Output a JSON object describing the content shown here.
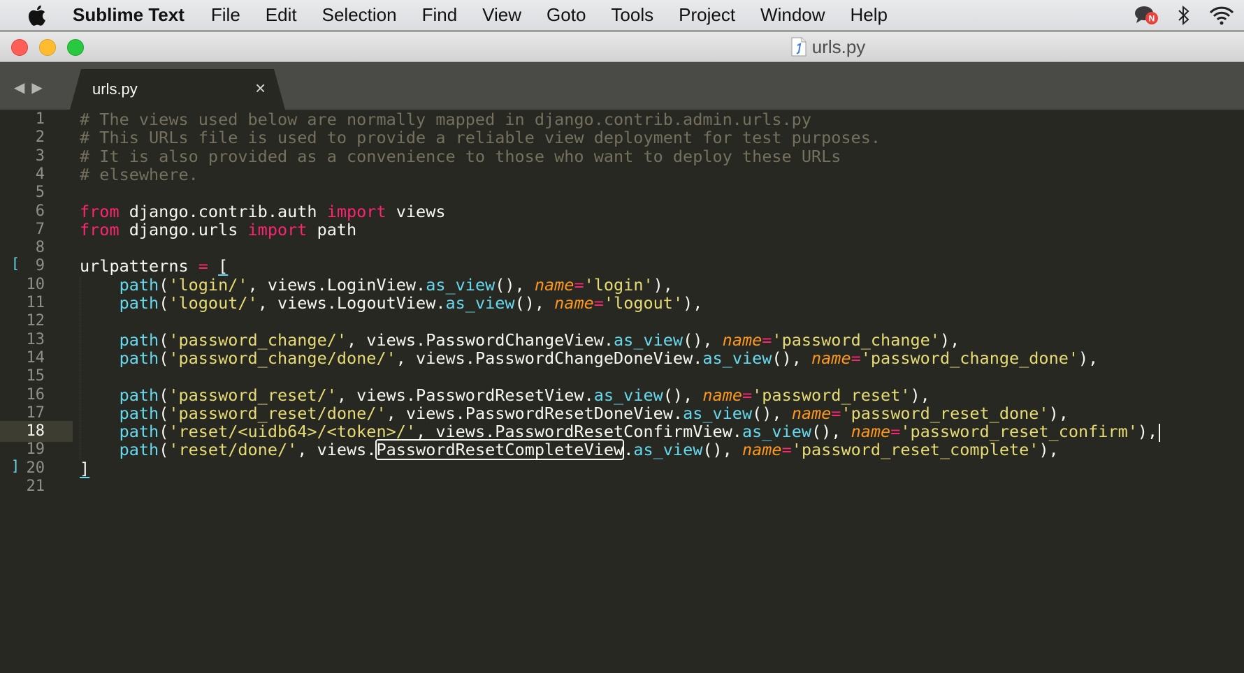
{
  "menubar": {
    "app_name": "Sublime Text",
    "items": [
      "File",
      "Edit",
      "Selection",
      "Find",
      "View",
      "Goto",
      "Tools",
      "Project",
      "Window",
      "Help"
    ],
    "status_icons": [
      "chat-notification-icon",
      "bluetooth-icon",
      "wifi-icon"
    ],
    "notification_badge": "N"
  },
  "window": {
    "title": "urls.py"
  },
  "tabs": [
    {
      "label": "urls.py",
      "active": true
    }
  ],
  "editor": {
    "active_line": 18,
    "line_numbers": [
      "1",
      "2",
      "3",
      "4",
      "5",
      "6",
      "7",
      "8",
      "9",
      "10",
      "11",
      "12",
      "13",
      "14",
      "15",
      "16",
      "17",
      "18",
      "19",
      "20",
      "21"
    ],
    "lines": [
      [
        {
          "t": "cm",
          "v": "# The views used below are normally mapped in django.contrib.admin.urls.py"
        }
      ],
      [
        {
          "t": "cm",
          "v": "# This URLs file is used to provide a reliable view deployment for test purposes."
        }
      ],
      [
        {
          "t": "cm",
          "v": "# It is also provided as a convenience to those who want to deploy these URLs"
        }
      ],
      [
        {
          "t": "cm",
          "v": "# elsewhere."
        }
      ],
      [],
      [
        {
          "t": "kw",
          "v": "from"
        },
        {
          "t": "",
          "v": " django.contrib.auth "
        },
        {
          "t": "kw",
          "v": "import"
        },
        {
          "t": "",
          "v": " views"
        }
      ],
      [
        {
          "t": "kw",
          "v": "from"
        },
        {
          "t": "",
          "v": " django.urls "
        },
        {
          "t": "kw",
          "v": "import"
        },
        {
          "t": "",
          "v": " path"
        }
      ],
      [],
      [
        {
          "t": "",
          "v": "urlpatterns "
        },
        {
          "t": "op",
          "v": "="
        },
        {
          "t": "",
          "v": " "
        },
        {
          "t": "bracket",
          "v": "["
        }
      ],
      [
        {
          "t": "",
          "v": "    "
        },
        {
          "t": "fn",
          "v": "path"
        },
        {
          "t": "",
          "v": "("
        },
        {
          "t": "st",
          "v": "'login/'"
        },
        {
          "t": "",
          "v": ", views.LoginView."
        },
        {
          "t": "fn",
          "v": "as_view"
        },
        {
          "t": "",
          "v": "(), "
        },
        {
          "t": "pa",
          "v": "name"
        },
        {
          "t": "op",
          "v": "="
        },
        {
          "t": "st",
          "v": "'login'"
        },
        {
          "t": "",
          "v": "),"
        }
      ],
      [
        {
          "t": "",
          "v": "    "
        },
        {
          "t": "fn",
          "v": "path"
        },
        {
          "t": "",
          "v": "("
        },
        {
          "t": "st",
          "v": "'logout/'"
        },
        {
          "t": "",
          "v": ", views.LogoutView."
        },
        {
          "t": "fn",
          "v": "as_view"
        },
        {
          "t": "",
          "v": "(), "
        },
        {
          "t": "pa",
          "v": "name"
        },
        {
          "t": "op",
          "v": "="
        },
        {
          "t": "st",
          "v": "'logout'"
        },
        {
          "t": "",
          "v": "),"
        }
      ],
      [],
      [
        {
          "t": "",
          "v": "    "
        },
        {
          "t": "fn",
          "v": "path"
        },
        {
          "t": "",
          "v": "("
        },
        {
          "t": "st",
          "v": "'password_change/'"
        },
        {
          "t": "",
          "v": ", views.PasswordChangeView."
        },
        {
          "t": "fn",
          "v": "as_view"
        },
        {
          "t": "",
          "v": "(), "
        },
        {
          "t": "pa",
          "v": "name"
        },
        {
          "t": "op",
          "v": "="
        },
        {
          "t": "st",
          "v": "'password_change'"
        },
        {
          "t": "",
          "v": "),"
        }
      ],
      [
        {
          "t": "",
          "v": "    "
        },
        {
          "t": "fn",
          "v": "path"
        },
        {
          "t": "",
          "v": "("
        },
        {
          "t": "st",
          "v": "'password_change/done/'"
        },
        {
          "t": "",
          "v": ", views.PasswordChangeDoneView."
        },
        {
          "t": "fn",
          "v": "as_view"
        },
        {
          "t": "",
          "v": "(), "
        },
        {
          "t": "pa",
          "v": "name"
        },
        {
          "t": "op",
          "v": "="
        },
        {
          "t": "st",
          "v": "'password_change_done'"
        },
        {
          "t": "",
          "v": "),"
        }
      ],
      [],
      [
        {
          "t": "",
          "v": "    "
        },
        {
          "t": "fn",
          "v": "path"
        },
        {
          "t": "",
          "v": "("
        },
        {
          "t": "st",
          "v": "'password_reset/'"
        },
        {
          "t": "",
          "v": ", views.PasswordResetView."
        },
        {
          "t": "fn",
          "v": "as_view"
        },
        {
          "t": "",
          "v": "(), "
        },
        {
          "t": "pa",
          "v": "name"
        },
        {
          "t": "op",
          "v": "="
        },
        {
          "t": "st",
          "v": "'password_reset'"
        },
        {
          "t": "",
          "v": "),"
        }
      ],
      [
        {
          "t": "",
          "v": "    "
        },
        {
          "t": "fn",
          "v": "path"
        },
        {
          "t": "",
          "v": "("
        },
        {
          "t": "st",
          "v": "'password_reset/done/'"
        },
        {
          "t": "",
          "v": ", views.PasswordResetDoneView."
        },
        {
          "t": "fn",
          "v": "as_view"
        },
        {
          "t": "",
          "v": "(), "
        },
        {
          "t": "pa",
          "v": "name"
        },
        {
          "t": "op",
          "v": "="
        },
        {
          "t": "st",
          "v": "'password_reset_done'"
        },
        {
          "t": "",
          "v": "),"
        }
      ],
      [
        {
          "t": "",
          "v": "    "
        },
        {
          "t": "fn",
          "v": "path"
        },
        {
          "t": "",
          "v": "("
        },
        {
          "t": "st",
          "v": "'reset/<uidb64>/<token>/'"
        },
        {
          "t": "",
          "v": ", views.PasswordResetConfirmView."
        },
        {
          "t": "fn",
          "v": "as_view"
        },
        {
          "t": "",
          "v": "(), "
        },
        {
          "t": "pa",
          "v": "name"
        },
        {
          "t": "op",
          "v": "="
        },
        {
          "t": "st",
          "v": "'password_reset_confirm'"
        },
        {
          "t": "",
          "v": "),"
        },
        {
          "t": "cursor",
          "v": ""
        }
      ],
      [
        {
          "t": "",
          "v": "    "
        },
        {
          "t": "fn",
          "v": "path"
        },
        {
          "t": "",
          "v": "("
        },
        {
          "t": "st",
          "v": "'reset/done/'"
        },
        {
          "t": "",
          "v": ", views."
        },
        {
          "t": "boxed",
          "v": "PasswordResetCompleteView"
        },
        {
          "t": "",
          "v": "."
        },
        {
          "t": "fn",
          "v": "as_view"
        },
        {
          "t": "",
          "v": "(), "
        },
        {
          "t": "pa",
          "v": "name"
        },
        {
          "t": "op",
          "v": "="
        },
        {
          "t": "st",
          "v": "'password_reset_complete'"
        },
        {
          "t": "",
          "v": "),"
        }
      ],
      [
        {
          "t": "bracket",
          "v": "]"
        }
      ],
      []
    ]
  }
}
